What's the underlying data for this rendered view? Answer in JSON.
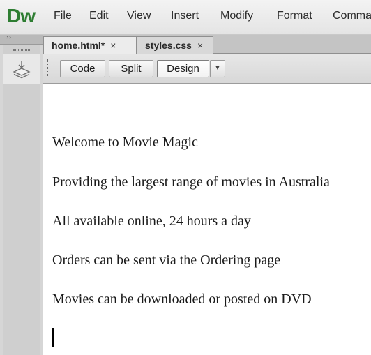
{
  "app": {
    "logo": "Dw",
    "menu": [
      "File",
      "Edit",
      "View",
      "Insert",
      "Modify",
      "Format",
      "Comma"
    ]
  },
  "colors": {
    "logo": "#2e7d32",
    "panel": "#d6d6d6",
    "toolbar": "#dedede"
  },
  "icons": {
    "panel_collapse": "double-chevron-right-icon",
    "insert_panel": "layers-icon",
    "tab_close": "close-icon",
    "view_dropdown": "triangle-down-icon"
  },
  "left_panel": {
    "collapse_glyph": "››"
  },
  "tabs": [
    {
      "label": "home.html*",
      "close": "×",
      "active": true
    },
    {
      "label": "styles.css",
      "close": "×",
      "active": false
    }
  ],
  "toolbar": {
    "code_label": "Code",
    "split_label": "Split",
    "design_label": "Design",
    "design_selected": true,
    "dropdown_glyph": "▼"
  },
  "document": {
    "paragraphs": [
      "Welcome to Movie Magic",
      "Providing the largest range of movies in Australia",
      "All available online, 24 hours a day",
      "Orders can be sent via the Ordering page",
      "Movies can be downloaded or posted on DVD"
    ]
  }
}
